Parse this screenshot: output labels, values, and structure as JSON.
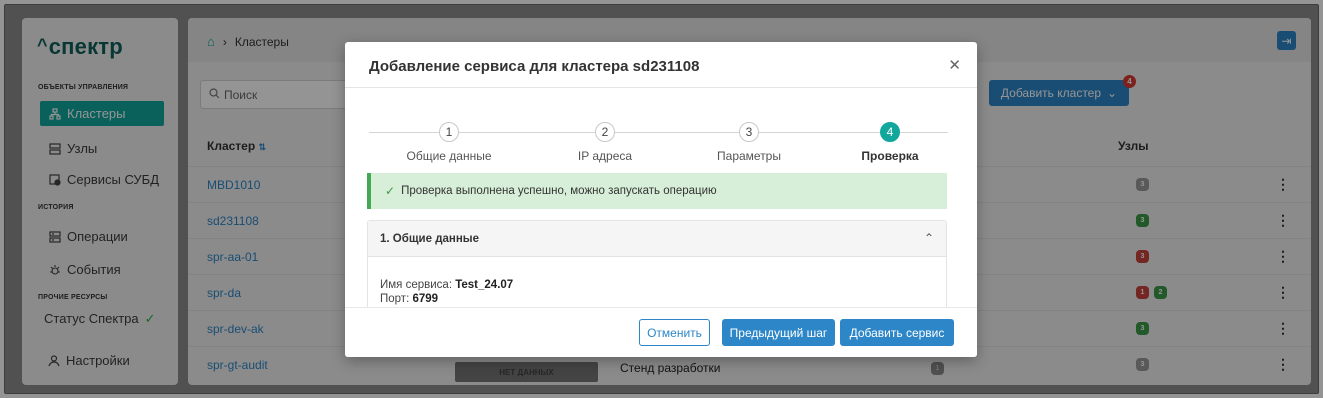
{
  "app": {
    "logo": "спектр"
  },
  "sidebar": {
    "sections": [
      {
        "title": "ОБЪЕКТЫ УПРАВЛЕНИЯ"
      },
      {
        "title": "ИСТОРИЯ"
      },
      {
        "title": "ПРОЧИЕ РЕСУРСЫ"
      }
    ],
    "items": [
      {
        "label": "Кластеры",
        "icon": "clusters-icon",
        "active": true
      },
      {
        "label": "Узлы",
        "icon": "nodes-icon"
      },
      {
        "label": "Сервисы СУБД",
        "icon": "db-services-icon"
      },
      {
        "label": "Операции",
        "icon": "operations-icon"
      },
      {
        "label": "События",
        "icon": "events-icon"
      },
      {
        "label": "Статус Спектра",
        "icon": "check-icon"
      },
      {
        "label": "Настройки",
        "icon": "user-icon"
      }
    ]
  },
  "header": {
    "breadcrumb": "Кластеры"
  },
  "toolbar": {
    "search_placeholder": "Поиск",
    "add_cluster_label": "Добавить кластер",
    "badge_count": "4"
  },
  "table": {
    "columns": {
      "cluster": "Кластер",
      "nodes": "Узлы"
    },
    "rows": [
      {
        "name": "MBD1010",
        "nodes": [
          {
            "n": "3",
            "color": "gray"
          }
        ]
      },
      {
        "name": "sd231108",
        "nodes": [
          {
            "n": "3",
            "color": "green"
          }
        ]
      },
      {
        "name": "spr-aa-01",
        "nodes": [
          {
            "n": "3",
            "color": "red"
          }
        ]
      },
      {
        "name": "spr-da",
        "nodes": [
          {
            "n": "1",
            "color": "red"
          },
          {
            "n": "2",
            "color": "green"
          }
        ]
      },
      {
        "name": "spr-dev-ak",
        "nodes": [
          {
            "n": "3",
            "color": "green"
          }
        ]
      },
      {
        "name": "spr-gt-audit",
        "nodes": [
          {
            "n": "3",
            "color": "gray"
          }
        ]
      }
    ],
    "last_row_status": "НЕТ ДАННЫХ",
    "last_row_env": "Стенд разработки",
    "last_row_env_count": "1"
  },
  "modal": {
    "title": "Добавление сервиса для кластера sd231108",
    "steps": [
      {
        "num": "1",
        "label": "Общие данные"
      },
      {
        "num": "2",
        "label": "IP адреса"
      },
      {
        "num": "3",
        "label": "Параметры"
      },
      {
        "num": "4",
        "label": "Проверка",
        "current": true
      }
    ],
    "alert": "Проверка выполнена успешно, можно запускать операцию",
    "section_title": "1. Общие данные",
    "service_name_label": "Имя сервиса:",
    "service_name_value": "Test_24.07",
    "port_label": "Порт:",
    "port_value": "6799",
    "buttons": {
      "cancel": "Отменить",
      "prev": "Предыдущий шаг",
      "add": "Добавить сервис"
    }
  }
}
